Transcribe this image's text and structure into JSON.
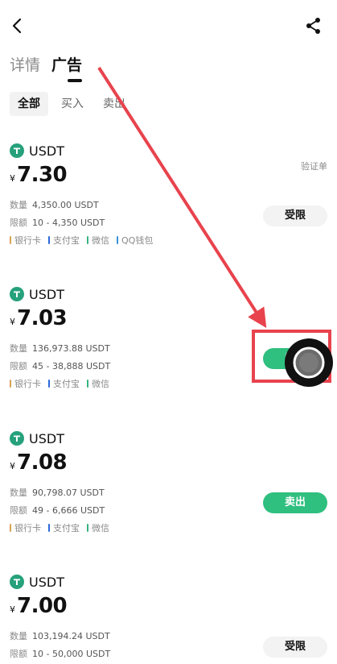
{
  "tabs": [
    {
      "label": "详情"
    },
    {
      "label": "广告"
    }
  ],
  "filters": [
    {
      "label": "全部"
    },
    {
      "label": "买入"
    },
    {
      "label": "卖出"
    }
  ],
  "verify_label": "验证单",
  "ads": [
    {
      "coin": "USDT",
      "currency": "¥",
      "price": "7.30",
      "qty_label": "数量",
      "qty": "4,350.00 USDT",
      "limit_label": "限额",
      "limit": "10 - 4,350 USDT",
      "payments": [
        {
          "name": "银行卡",
          "color": "#d9a15a"
        },
        {
          "name": "支付宝",
          "color": "#2a6ad9"
        },
        {
          "name": "微信",
          "color": "#35b37e"
        },
        {
          "name": "QQ钱包",
          "color": "#3f8fd9"
        }
      ],
      "action": "受限"
    },
    {
      "coin": "USDT",
      "currency": "¥",
      "price": "7.03",
      "qty_label": "数量",
      "qty": "136,973.88 USDT",
      "limit_label": "限额",
      "limit": "45 - 38,888 USDT",
      "payments": [
        {
          "name": "银行卡",
          "color": "#d9a15a"
        },
        {
          "name": "支付宝",
          "color": "#2a6ad9"
        },
        {
          "name": "微信",
          "color": "#35b37e"
        }
      ],
      "action": "卖出"
    },
    {
      "coin": "USDT",
      "currency": "¥",
      "price": "7.08",
      "qty_label": "数量",
      "qty": "90,798.07 USDT",
      "limit_label": "限额",
      "limit": "49 - 6,666 USDT",
      "payments": [
        {
          "name": "银行卡",
          "color": "#d9a15a"
        },
        {
          "name": "支付宝",
          "color": "#2a6ad9"
        },
        {
          "name": "微信",
          "color": "#35b37e"
        }
      ],
      "action": "卖出"
    },
    {
      "coin": "USDT",
      "currency": "¥",
      "price": "7.00",
      "qty_label": "数量",
      "qty": "103,194.24 USDT",
      "limit_label": "限额",
      "limit": "10 - 50,000 USDT",
      "payments": [],
      "action": "受限"
    }
  ],
  "colors": {
    "accent": "#2fbf7f",
    "tether": "#26a17b",
    "annotation": "#e8434d"
  },
  "icons": {
    "back": "chevron-left-icon",
    "share": "share-icon"
  }
}
